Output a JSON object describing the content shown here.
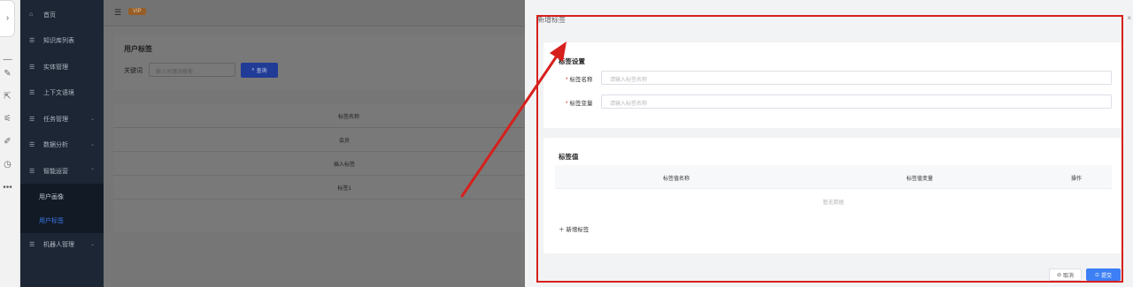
{
  "sidebar": {
    "items": [
      {
        "label": "首页",
        "icon": "home-icon"
      },
      {
        "label": "知识库列表",
        "icon": "list-icon"
      },
      {
        "label": "实体管理",
        "icon": "list-icon"
      },
      {
        "label": "上下文语境",
        "icon": "list-icon"
      },
      {
        "label": "任务管理",
        "icon": "list-icon",
        "has_chevron": true
      },
      {
        "label": "数据分析",
        "icon": "list-icon",
        "has_chevron": true
      },
      {
        "label": "智能运营",
        "icon": "list-icon",
        "expanded": true
      },
      {
        "label": "机器人管理",
        "icon": "list-icon",
        "has_chevron": true
      }
    ],
    "sub_items": [
      {
        "label": "用户画像"
      },
      {
        "label": "用户标签",
        "active": true
      }
    ],
    "active_color": "#3d7ff5"
  },
  "header": {
    "badge": "VIP",
    "badge_color": "#a0642a"
  },
  "search_card": {
    "title": "用户标签",
    "keyword_label": "关键词",
    "keyword_placeholder": "输入关键词搜索",
    "search_button": "查询",
    "search_icon": "search-icon"
  },
  "tag_table": {
    "column_header": "标签名称",
    "rows": [
      "会员",
      "插入标签",
      "标签1"
    ]
  },
  "dialog": {
    "title": "新增标签",
    "close": "×",
    "settings_section": {
      "title": "标签设置",
      "name_label": "标签名称",
      "name_placeholder": "请输入标签名称",
      "variable_label": "标签变量",
      "variable_placeholder": "请输入标签名称",
      "required_mark": "*"
    },
    "values_section": {
      "title": "标签值",
      "columns": [
        "标签值名称",
        "标签值变量",
        "操作"
      ],
      "empty_text": "暂无数据",
      "add_button": "新增标签"
    },
    "cancel_button": "取消",
    "submit_button": "提交",
    "primary_color": "#3d7ff5"
  },
  "annotation": {
    "highlight_color": "#d6201c"
  }
}
